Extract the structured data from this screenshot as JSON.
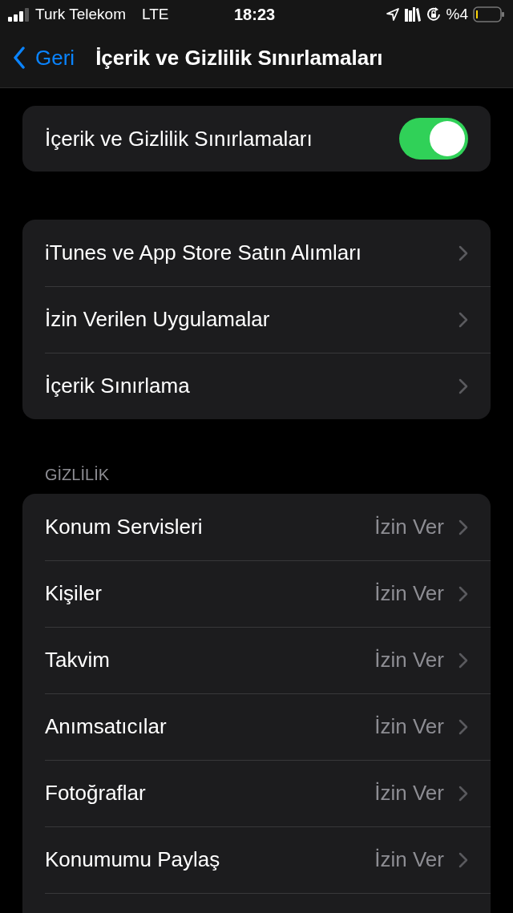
{
  "status_bar": {
    "carrier": "Turk Telekom",
    "network": "LTE",
    "time": "18:23",
    "battery": "%4"
  },
  "nav": {
    "back": "Geri",
    "title": "İçerik ve Gizlilik Sınırlamaları"
  },
  "master_toggle": {
    "label": "İçerik ve Gizlilik Sınırlamaları",
    "on": true
  },
  "menu": [
    {
      "label": "iTunes ve App Store Satın Alımları"
    },
    {
      "label": "İzin Verilen Uygulamalar"
    },
    {
      "label": "İçerik Sınırlama"
    }
  ],
  "privacy": {
    "header": "GİZLİLİK",
    "items": [
      {
        "label": "Konum Servisleri",
        "value": "İzin Ver"
      },
      {
        "label": "Kişiler",
        "value": "İzin Ver"
      },
      {
        "label": "Takvim",
        "value": "İzin Ver"
      },
      {
        "label": "Anımsatıcılar",
        "value": "İzin Ver"
      },
      {
        "label": "Fotoğraflar",
        "value": "İzin Ver"
      },
      {
        "label": "Konumumu Paylaş",
        "value": "İzin Ver"
      }
    ]
  }
}
